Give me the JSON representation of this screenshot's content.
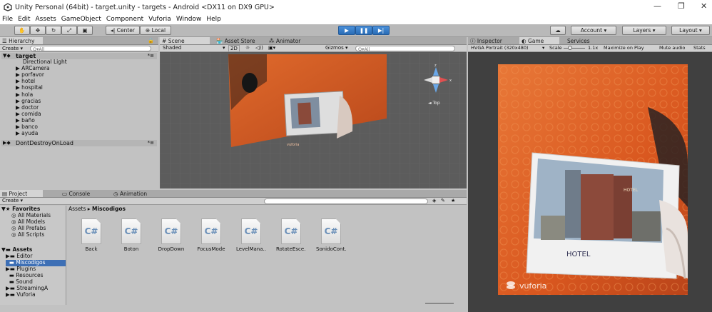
{
  "window": {
    "title": "Unity Personal (64bit) - target.unity - targets - Android <DX11 on DX9 GPU>",
    "minimize": "—",
    "maximize": "❐",
    "close": "✕"
  },
  "menu": [
    "File",
    "Edit",
    "Assets",
    "GameObject",
    "Component",
    "Vuforia",
    "Window",
    "Help"
  ],
  "toolbar": {
    "center": "Center",
    "local": "Local",
    "account": "Account",
    "layers": "Layers",
    "layout": "Layout"
  },
  "hierarchy": {
    "tab": "Hierarchy",
    "create": "Create",
    "search": "Q▾All",
    "scene": "target",
    "items": [
      "Directional Light",
      "ARCamera",
      "porfavor",
      "hotel",
      "hospital",
      "hola",
      "gracias",
      "doctor",
      "comida",
      "baño",
      "banco",
      "ayuda"
    ],
    "dont_destroy": "DontDestroyOnLoad"
  },
  "scene": {
    "tabs": [
      "Scene",
      "Asset Store",
      "Animator"
    ],
    "shading": "Shaded",
    "mode": "2D",
    "gizmos": "Gizmos",
    "search": "Q▾All",
    "top_label": "◄ Top",
    "watermark": "vuforia"
  },
  "game": {
    "tabs": [
      "Inspector",
      "Game",
      "Services"
    ],
    "resolution": "HVGA Portrait (320x480)",
    "scale": "Scale",
    "scale_value": "1.1x",
    "options": [
      "Maximize on Play",
      "Mute audio",
      "Stats"
    ],
    "card_text": "HOTEL",
    "sign_text": "HOTEL",
    "watermark": "vuforia"
  },
  "project": {
    "tabs": [
      "Project",
      "Console",
      "Animation"
    ],
    "create": "Create",
    "favorites": "Favorites",
    "favorite_items": [
      "All Materials",
      "All Models",
      "All Prefabs",
      "All Scripts"
    ],
    "assets": "Assets",
    "asset_folders": [
      "Editor",
      "Miscodigos",
      "Plugins",
      "Resources",
      "Sound",
      "StreamingA",
      "Vuforia"
    ],
    "breadcrumb": [
      "Assets",
      "Miscodigos"
    ],
    "files": [
      "Back",
      "Boton",
      "DropDown",
      "FocusMode",
      "LevelMana..",
      "RotateEsce..",
      "SonidoCont.."
    ],
    "file_glyph": "C#"
  },
  "colors": {
    "accent": "#3d6fb5",
    "play": "#2a6cb5",
    "orange": "#d8531f"
  }
}
